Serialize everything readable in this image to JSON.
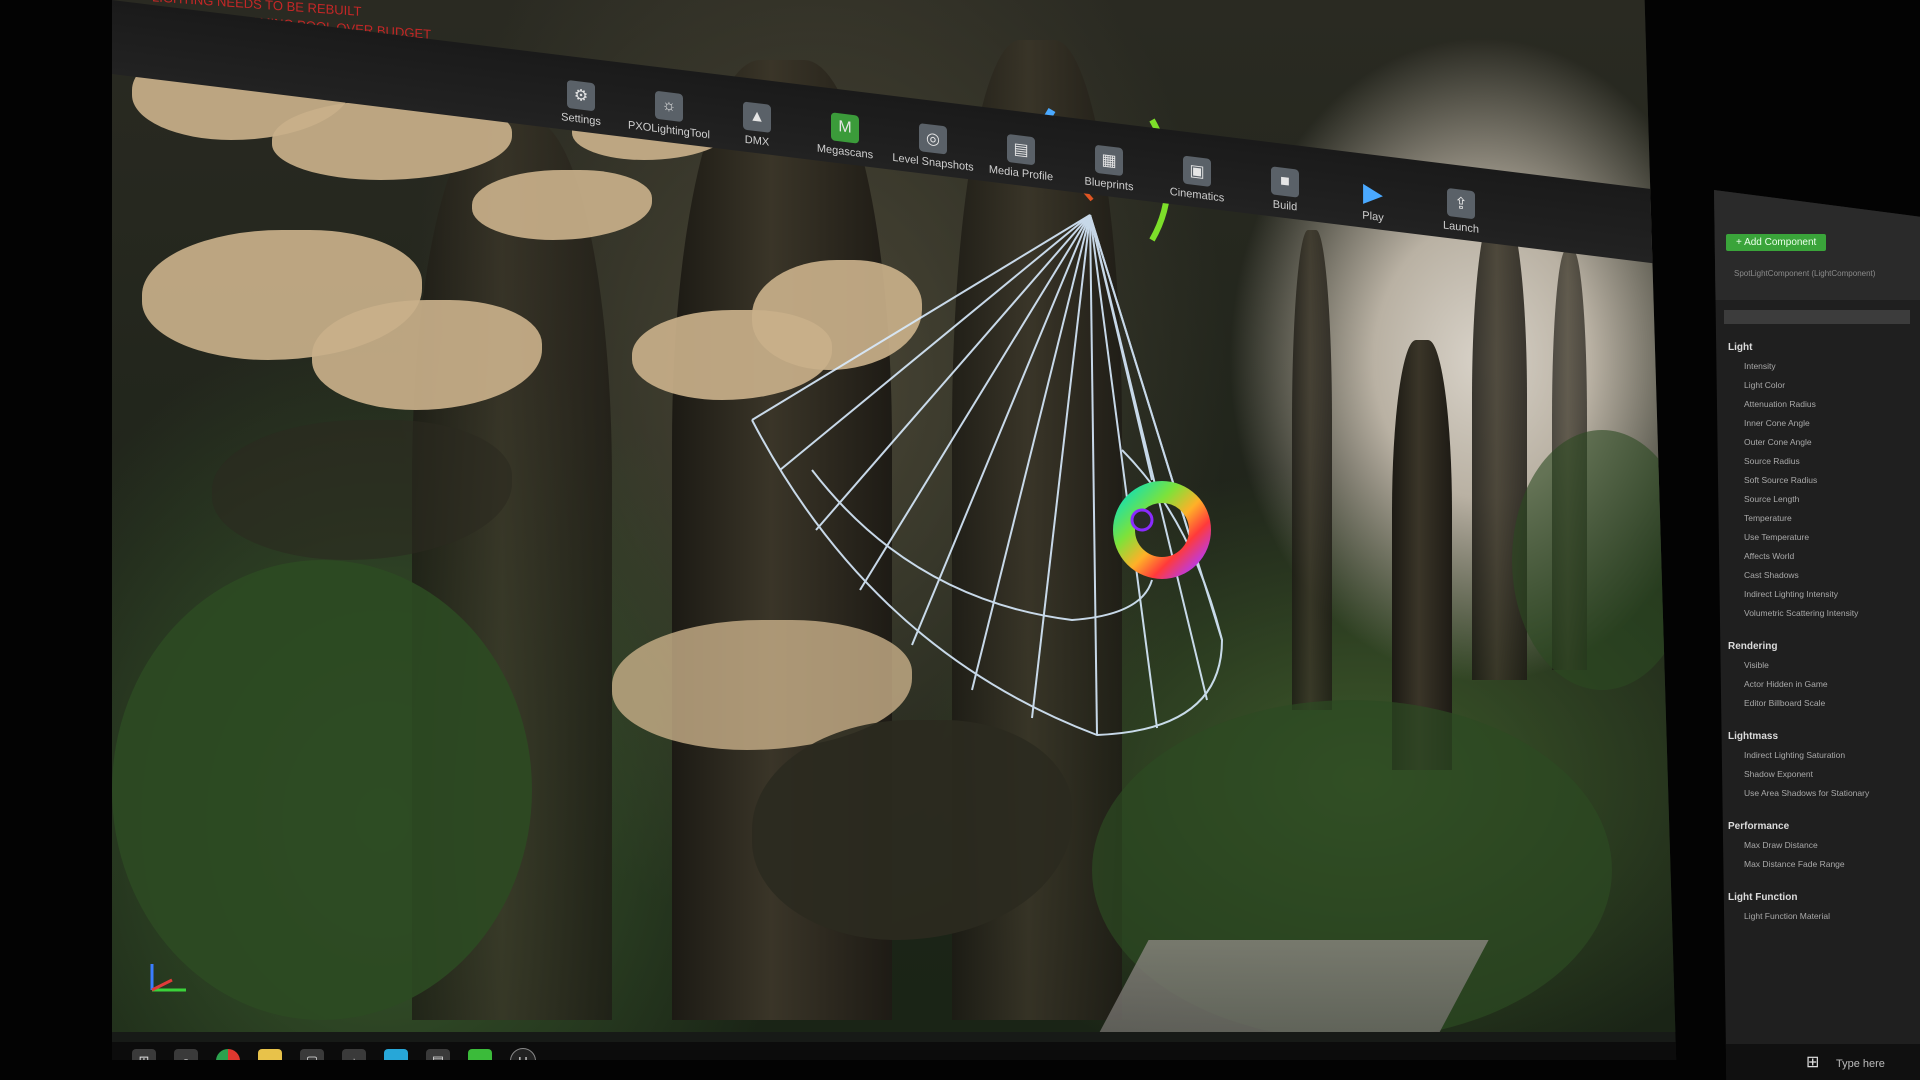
{
  "toolbar": {
    "items": [
      {
        "label": "Settings",
        "icon": "gear-icon"
      },
      {
        "label": "PXOLightingTool",
        "icon": "light-tool-icon"
      },
      {
        "label": "DMX",
        "icon": "dmx-icon"
      },
      {
        "label": "Megascans",
        "icon": "megascans-icon"
      },
      {
        "label": "Level Snapshots",
        "icon": "snapshot-icon"
      },
      {
        "label": "Media Profile",
        "icon": "media-profile-icon"
      },
      {
        "label": "Blueprints",
        "icon": "blueprint-icon"
      },
      {
        "label": "Cinematics",
        "icon": "clapper-icon"
      },
      {
        "label": "Build",
        "icon": "build-icon"
      },
      {
        "label": "Play",
        "icon": "play-icon"
      },
      {
        "label": "Launch",
        "icon": "launch-icon"
      }
    ]
  },
  "viewport": {
    "warning_lines": [
      "LIGHTING NEEDS TO BE REBUILT",
      "TEXTURE STREAMING POOL OVER BUDGET"
    ]
  },
  "details_panel": {
    "add_component": "+ Add Component",
    "component": "SpotLightComponent (LightComponent)",
    "sections": [
      {
        "title": "Light",
        "rows": [
          "Intensity",
          "Light Color",
          "Attenuation Radius",
          "Inner Cone Angle",
          "Outer Cone Angle",
          "Source Radius",
          "Soft Source Radius",
          "Source Length",
          "Temperature",
          "Use Temperature",
          "Affects World",
          "Cast Shadows",
          "Indirect Lighting Intensity",
          "Volumetric Scattering Intensity"
        ]
      },
      {
        "title": "Rendering",
        "rows": [
          "Visible",
          "Actor Hidden in Game",
          "Editor Billboard Scale"
        ]
      },
      {
        "title": "Lightmass",
        "rows": [
          "Indirect Lighting Saturation",
          "Shadow Exponent",
          "Use Area Shadows for Stationary"
        ]
      },
      {
        "title": "Performance",
        "rows": [
          "Max Draw Distance",
          "Max Distance Fade Range"
        ]
      },
      {
        "title": "Light Function",
        "rows": [
          "Light Function Material"
        ]
      }
    ],
    "search_placeholder": "Type here"
  },
  "colors": {
    "accent_green": "#3b9b3a",
    "warning_red": "#c52727",
    "play_blue": "#4aa9ff"
  }
}
